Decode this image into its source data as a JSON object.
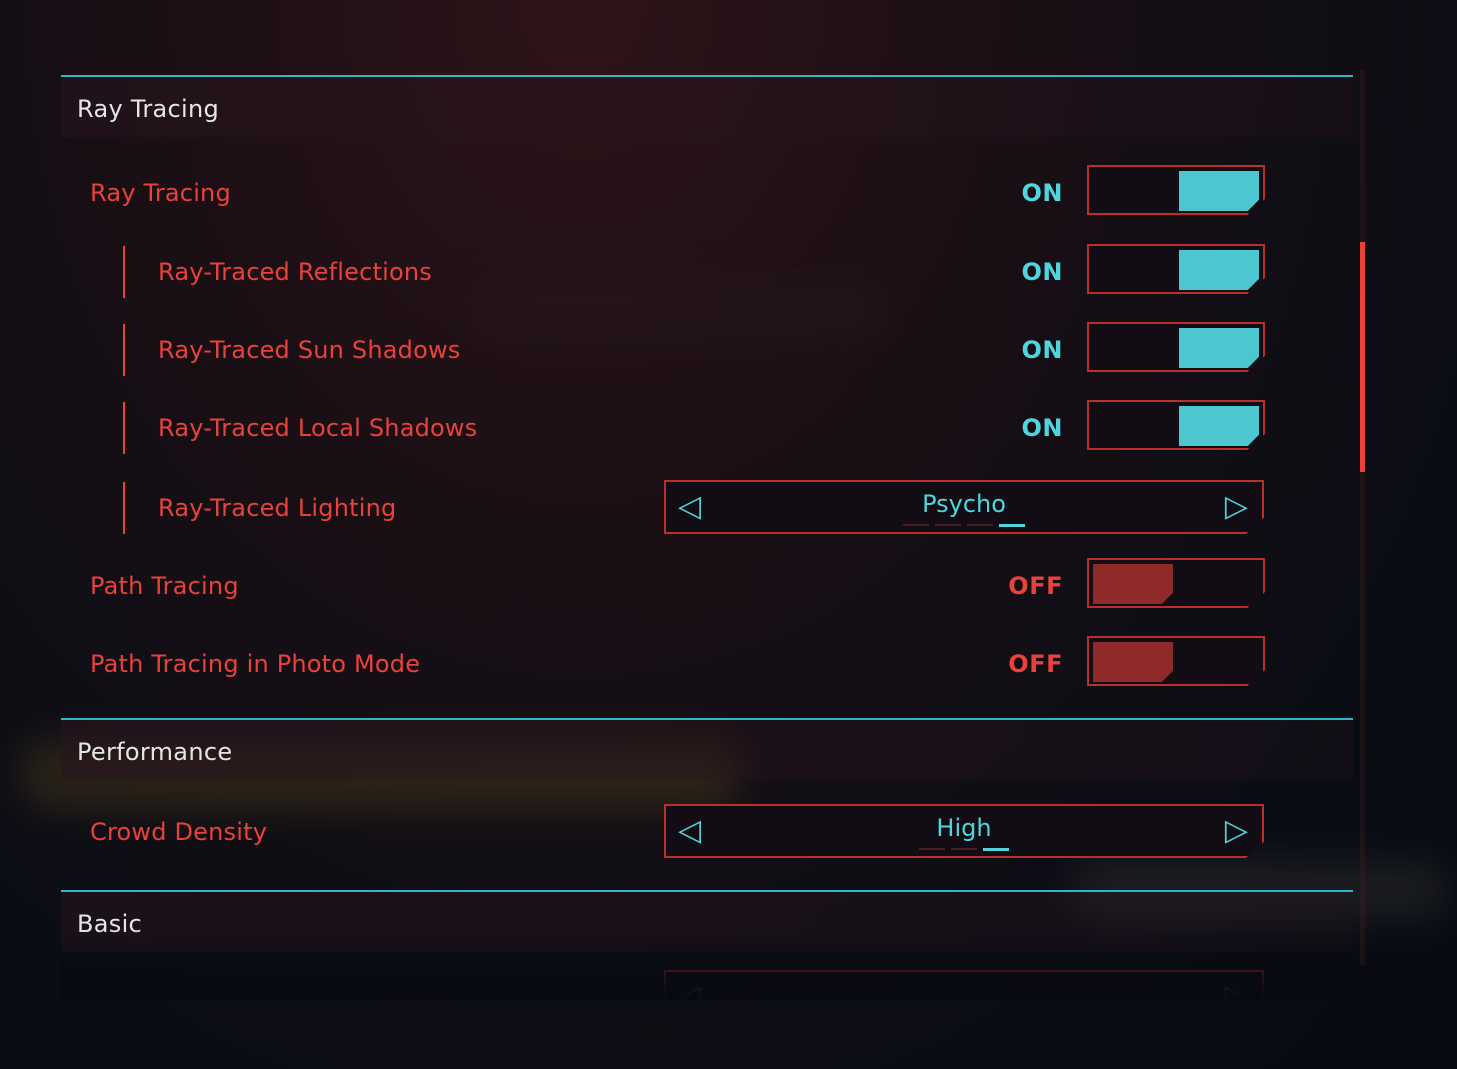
{
  "sections": {
    "ray_tracing": {
      "title": "Ray Tracing"
    },
    "performance": {
      "title": "Performance"
    },
    "basic": {
      "title": "Basic"
    }
  },
  "settings": {
    "ray_tracing": {
      "label": "Ray Tracing",
      "state": "ON"
    },
    "rt_reflections": {
      "label": "Ray-Traced Reflections",
      "state": "ON"
    },
    "rt_sun_shadows": {
      "label": "Ray-Traced Sun Shadows",
      "state": "ON"
    },
    "rt_local_shadows": {
      "label": "Ray-Traced Local Shadows",
      "state": "ON"
    },
    "rt_lighting": {
      "label": "Ray-Traced Lighting",
      "value": "Psycho",
      "level": 4,
      "levels": 4
    },
    "path_tracing": {
      "label": "Path Tracing",
      "state": "OFF"
    },
    "path_tracing_photo": {
      "label": "Path Tracing in Photo Mode",
      "state": "OFF"
    },
    "crowd_density": {
      "label": "Crowd Density",
      "value": "High",
      "level": 3,
      "levels": 3
    }
  },
  "icons": {
    "left_arrow": "left-triangle-outline",
    "right_arrow": "right-triangle-outline"
  },
  "colors": {
    "accent_cyan": "#4fd6dc",
    "accent_red": "#e8423b",
    "header_line": "#2fb7c4",
    "off_knob": "#8e2a2a"
  }
}
